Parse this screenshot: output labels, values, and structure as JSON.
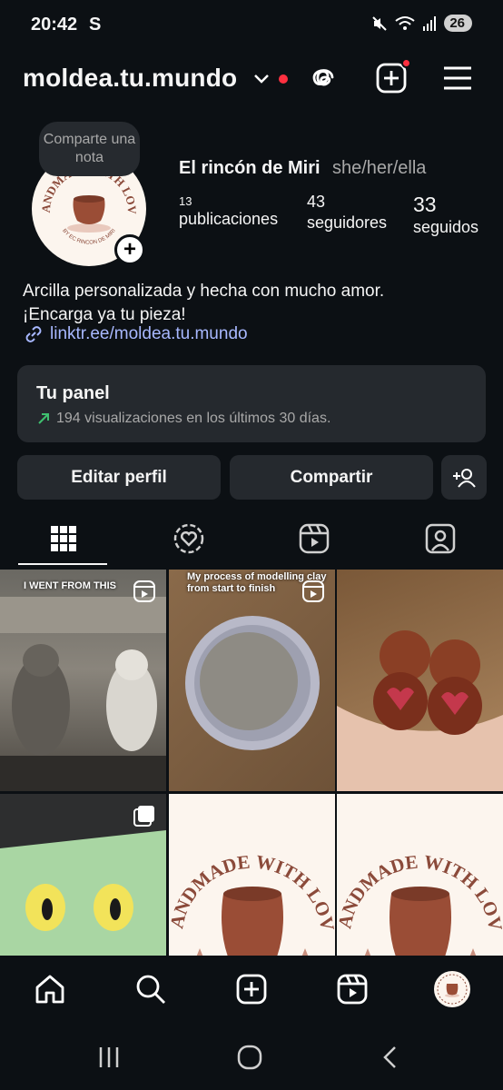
{
  "status": {
    "time": "20:42",
    "carrier_icon": "S",
    "battery": "26",
    "icons": [
      "mute-icon",
      "wifi-icon",
      "signal-icon"
    ]
  },
  "header": {
    "username": "moldea.tu.mundo",
    "icons": [
      "chevron-down-icon",
      "threads-icon",
      "create-icon",
      "menu-icon"
    ],
    "accent": "#ff3040"
  },
  "profile": {
    "note_bubble": "Comparte una nota",
    "display_name": "El rincón de Miri",
    "pronouns": "she/her/ella",
    "stats": {
      "posts_count": "13",
      "posts_label": "publicaciones",
      "followers_count": "43",
      "followers_label": "seguidores",
      "following_count": "33",
      "following_label": "seguidos"
    },
    "bio_line1": "Arcilla personalizada y hecha con mucho amor.",
    "bio_line2": "¡Encarga ya tu pieza!",
    "link": "linktr.ee/moldea.tu.mundo",
    "avatar_logo_text": "HANDMADE WITH LOVE",
    "avatar_logo_sub": "BY EC RINCON DE MIRI"
  },
  "panel": {
    "title": "Tu panel",
    "subtitle": "194 visualizaciones en los últimos 30 días."
  },
  "actions": {
    "edit": "Editar perfil",
    "share": "Compartir"
  },
  "tabs": [
    "grid-icon",
    "collab-icon",
    "reels-icon",
    "tagged-icon"
  ],
  "posts": [
    {
      "caption": "I WENT FROM THIS",
      "badge": "reel-icon"
    },
    {
      "caption": "My process of modelling clay from start to finish",
      "badge": "reel-icon"
    },
    {
      "caption": "",
      "badge": ""
    },
    {
      "caption": "",
      "badge": "carousel-icon"
    },
    {
      "caption": "HANDMADE WITH LOVE",
      "badge": ""
    },
    {
      "caption": "HANDMADE WITH LOVE",
      "badge": ""
    }
  ],
  "bottom_nav": [
    "home-icon",
    "search-icon",
    "create-icon",
    "reels-icon",
    "profile-avatar"
  ],
  "system_nav": [
    "recent-apps-icon",
    "home-button-icon",
    "back-icon"
  ]
}
